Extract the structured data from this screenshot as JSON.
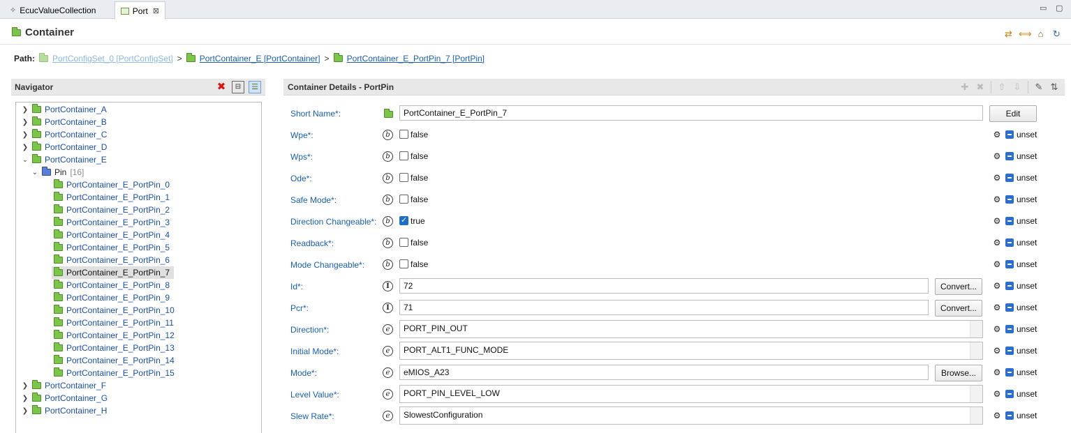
{
  "tabs": [
    {
      "label": "EcucValueCollection",
      "icon": "diamond-icon"
    },
    {
      "label": "Port",
      "icon": "port-module-icon",
      "close": "⊠"
    }
  ],
  "header": {
    "title": "Container"
  },
  "path": {
    "label": "Path:",
    "items": [
      "PortConfigSet_0 [PortConfigSet]",
      "PortContainer_E [PortContainer]",
      "PortContainer_E_PortPin_7 [PortPin]"
    ],
    "separator": ">"
  },
  "navigator": {
    "title": "Navigator",
    "tree": [
      {
        "label": "PortContainer_A",
        "expanded": false
      },
      {
        "label": "PortContainer_B",
        "expanded": false
      },
      {
        "label": "PortContainer_C",
        "expanded": false
      },
      {
        "label": "PortContainer_D",
        "expanded": false
      },
      {
        "label": "PortContainer_E",
        "expanded": true
      },
      {
        "label": "Pin",
        "count": "[16]"
      },
      {
        "label": "PortContainer_E_PortPin_0"
      },
      {
        "label": "PortContainer_E_PortPin_1"
      },
      {
        "label": "PortContainer_E_PortPin_2"
      },
      {
        "label": "PortContainer_E_PortPin_3"
      },
      {
        "label": "PortContainer_E_PortPin_4"
      },
      {
        "label": "PortContainer_E_PortPin_5"
      },
      {
        "label": "PortContainer_E_PortPin_6"
      },
      {
        "label": "PortContainer_E_PortPin_7",
        "selected": true
      },
      {
        "label": "PortContainer_E_PortPin_8"
      },
      {
        "label": "PortContainer_E_PortPin_9"
      },
      {
        "label": "PortContainer_E_PortPin_10"
      },
      {
        "label": "PortContainer_E_PortPin_11"
      },
      {
        "label": "PortContainer_E_PortPin_12"
      },
      {
        "label": "PortContainer_E_PortPin_13"
      },
      {
        "label": "PortContainer_E_PortPin_14"
      },
      {
        "label": "PortContainer_E_PortPin_15"
      },
      {
        "label": "PortContainer_F",
        "expanded": false
      },
      {
        "label": "PortContainer_G",
        "expanded": false
      },
      {
        "label": "PortContainer_H",
        "expanded": false
      }
    ]
  },
  "details": {
    "title": "Container Details - PortPin",
    "fields": [
      {
        "label": "Short Name*:",
        "value": "PortContainer_E_PortPin_7",
        "button": "Edit"
      },
      {
        "label": "Wpe*:",
        "value": "false",
        "checked": false,
        "unset": "unset"
      },
      {
        "label": "Wps*:",
        "value": "false",
        "checked": false,
        "unset": "unset"
      },
      {
        "label": "Ode*:",
        "value": "false",
        "checked": false,
        "unset": "unset"
      },
      {
        "label": "Safe Mode*:",
        "value": "false",
        "checked": false,
        "unset": "unset"
      },
      {
        "label": "Direction Changeable*:",
        "value": "true",
        "checked": true,
        "unset": "unset"
      },
      {
        "label": "Readback*:",
        "value": "false",
        "checked": false,
        "unset": "unset"
      },
      {
        "label": "Mode Changeable*:",
        "value": "false",
        "checked": false,
        "unset": "unset"
      },
      {
        "label": "Id*:",
        "value": "72",
        "button": "Convert...",
        "unset": "unset"
      },
      {
        "label": "Pcr*:",
        "value": "71",
        "button": "Convert...",
        "unset": "unset"
      },
      {
        "label": "Direction*:",
        "value": "PORT_PIN_OUT",
        "unset": "unset"
      },
      {
        "label": "Initial Mode*:",
        "value": "PORT_ALT1_FUNC_MODE",
        "unset": "unset"
      },
      {
        "label": "Mode*:",
        "value": "eMIOS_A23",
        "button": "Browse...",
        "unset": "unset"
      },
      {
        "label": "Level Value*:",
        "value": "PORT_PIN_LEVEL_LOW",
        "unset": "unset"
      },
      {
        "label": "Slew Rate*:",
        "value": "SlowestConfiguration",
        "unset": "unset"
      }
    ]
  },
  "glyphs": {
    "boolean": "b",
    "integer": "I",
    "enum": "e"
  },
  "colors": {
    "link": "#1a5fb4",
    "folder_green": "#7cc44a",
    "folder_blue": "#5b7fd6",
    "check_on": "#1f6fc9"
  }
}
